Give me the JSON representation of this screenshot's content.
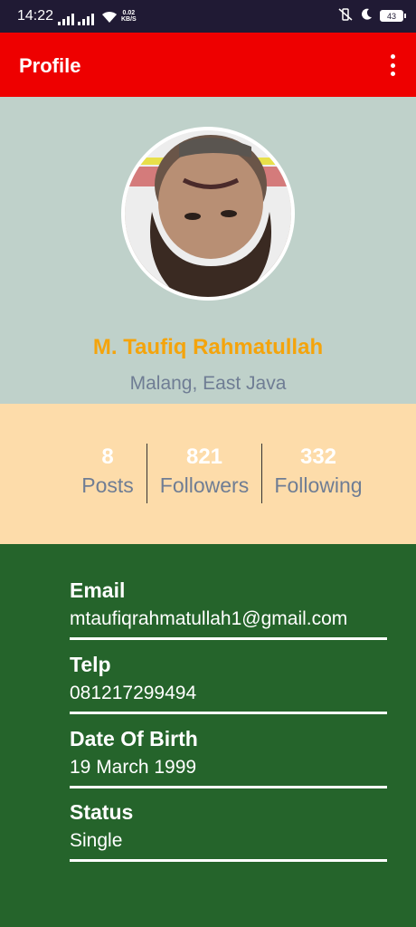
{
  "status_bar": {
    "time": "14:22",
    "net_speed_value": "0.02",
    "net_speed_unit": "KB/S",
    "battery": "43"
  },
  "app_bar": {
    "title": "Profile"
  },
  "profile": {
    "name": "M. Taufiq Rahmatullah",
    "location": "Malang, East Java"
  },
  "stats": [
    {
      "value": "8",
      "label": "Posts"
    },
    {
      "value": "821",
      "label": "Followers"
    },
    {
      "value": "332",
      "label": "Following"
    }
  ],
  "details": [
    {
      "label": "Email",
      "value": "mtaufiqrahmatullah1@gmail.com"
    },
    {
      "label": "Telp",
      "value": "081217299494"
    },
    {
      "label": "Date Of Birth",
      "value": "19 March 1999"
    },
    {
      "label": "Status",
      "value": "Single"
    }
  ],
  "colors": {
    "app_bar": "#ee0000",
    "header_bg": "#bfd1ca",
    "stats_bg": "#fddcaa",
    "info_bg": "#25642b",
    "name": "#f4a40c",
    "secondary_text": "#6f7d94"
  }
}
